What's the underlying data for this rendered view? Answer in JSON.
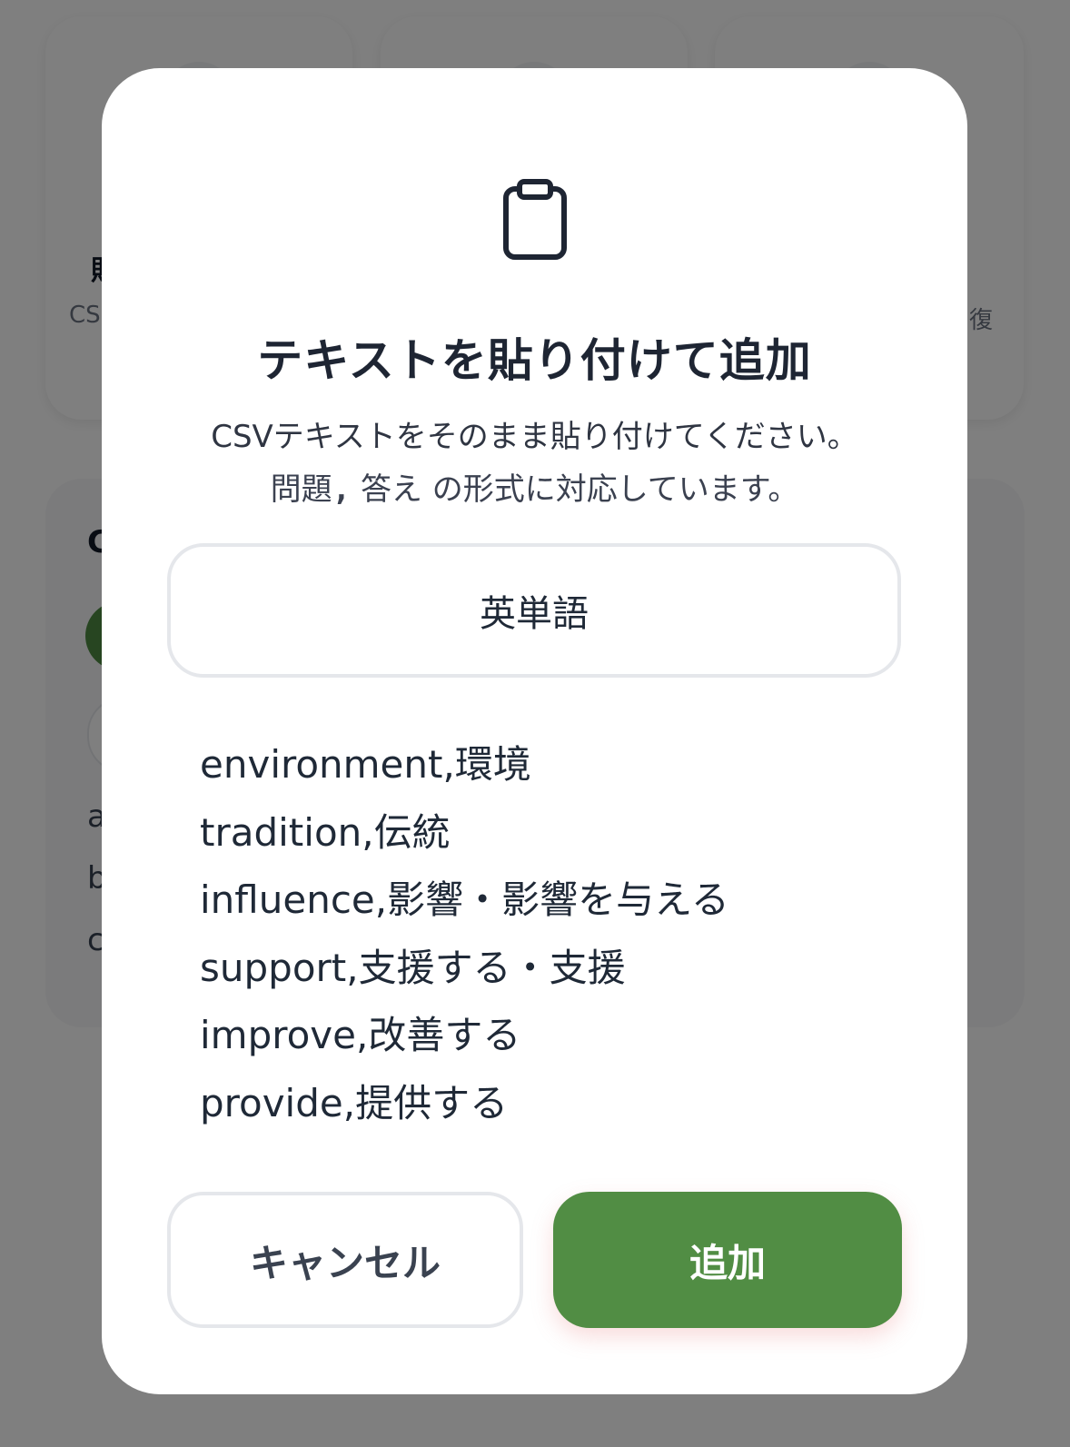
{
  "background": {
    "cards": [
      {
        "title": "貼",
        "subtitle": "CS"
      },
      {
        "title": "",
        "subtitle": ""
      },
      {
        "title": "",
        "subtitle": "復"
      }
    ],
    "panel": {
      "heading": "C",
      "rows": [
        "a",
        "b",
        "c"
      ]
    }
  },
  "modal": {
    "icon": "clipboard-icon",
    "title": "テキストを貼り付けて追加",
    "description_line1": "CSVテキストをそのまま貼り付けてください。",
    "description_line2_prefix": "問題",
    "description_line2_code": ",",
    "description_line2_mid": "答え",
    "description_line2_suffix": "の形式に対応しています。",
    "name_input_value": "英単語",
    "csv_lines": [
      "environment,環境",
      "tradition,伝統",
      "influence,影響・影響を与える",
      "support,支援する・支援",
      "improve,改善する",
      "provide,提供する"
    ],
    "cancel_label": "キャンセル",
    "add_label": "追加"
  },
  "colors": {
    "accent_green": "#518d44",
    "text_dark": "#1e2533",
    "border_gray": "#e5e7eb",
    "overlay": "rgba(0,0,0,0.5)"
  }
}
